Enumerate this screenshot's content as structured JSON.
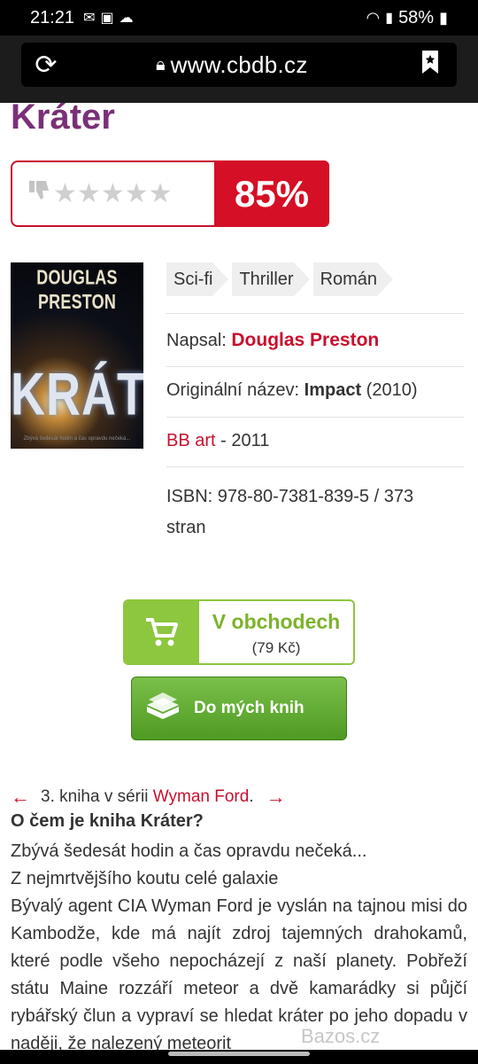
{
  "status_bar": {
    "time": "21:21",
    "battery": "58%"
  },
  "browser": {
    "url": "www.cbdb.cz"
  },
  "book": {
    "title": "Kráter",
    "rating_percent": "85%",
    "stars_filled": 0,
    "stars_total": 5,
    "cover": {
      "author": "DOUGLAS PRESTON",
      "title": "KRÁTER",
      "tagline": "Zbývá šedesát hodin a čas opravdu nečeká..."
    },
    "genres": [
      "Sci-fi",
      "Thriller",
      "Román"
    ],
    "author_label": "Napsal:",
    "author": "Douglas Preston",
    "original_title_label": "Originální název:",
    "original_title": "Impact",
    "original_year": "(2010)",
    "publisher": "BB art",
    "publisher_year": "- 2011",
    "isbn_line": "ISBN: 978-80-7381-839-5  /  373",
    "pages_word": "stran"
  },
  "shop": {
    "label": "V obchodech",
    "price": "(79 Kč)"
  },
  "my_books_label": "Do mých knih",
  "series": {
    "prefix": "3. kniha v sérii",
    "name": "Wyman Ford",
    "suffix": "."
  },
  "about": {
    "heading": "O čem je kniha Kráter?",
    "lines": [
      "Zbývá šedesát hodin a čas opravdu nečeká...",
      "Z nejmrtvějšího koutu celé galaxie",
      "Bývalý agent CIA Wyman Ford je vyslán na tajnou misi do Kambodže, kde má najít zdroj tajemných drahokamů, které podle všeho nepocházejí z naší planety. Pobřeží státu Maine rozzáří meteor a dvě kamarádky si půjčí rybářský člun a vypraví se hledat kráter po jeho dopadu v naději, že nalezený meteorit"
    ]
  },
  "watermark": "Bazos.cz",
  "icons": {
    "reload": "reload-icon",
    "lock": "lock-icon",
    "bookmark": "bookmark-icon",
    "cart": "cart-icon",
    "books": "books-icon",
    "thumb": "thumbs-down-icon"
  },
  "colors": {
    "accent_red": "#d50f25",
    "title_purple": "#7a3077",
    "green": "#8dc63f"
  }
}
